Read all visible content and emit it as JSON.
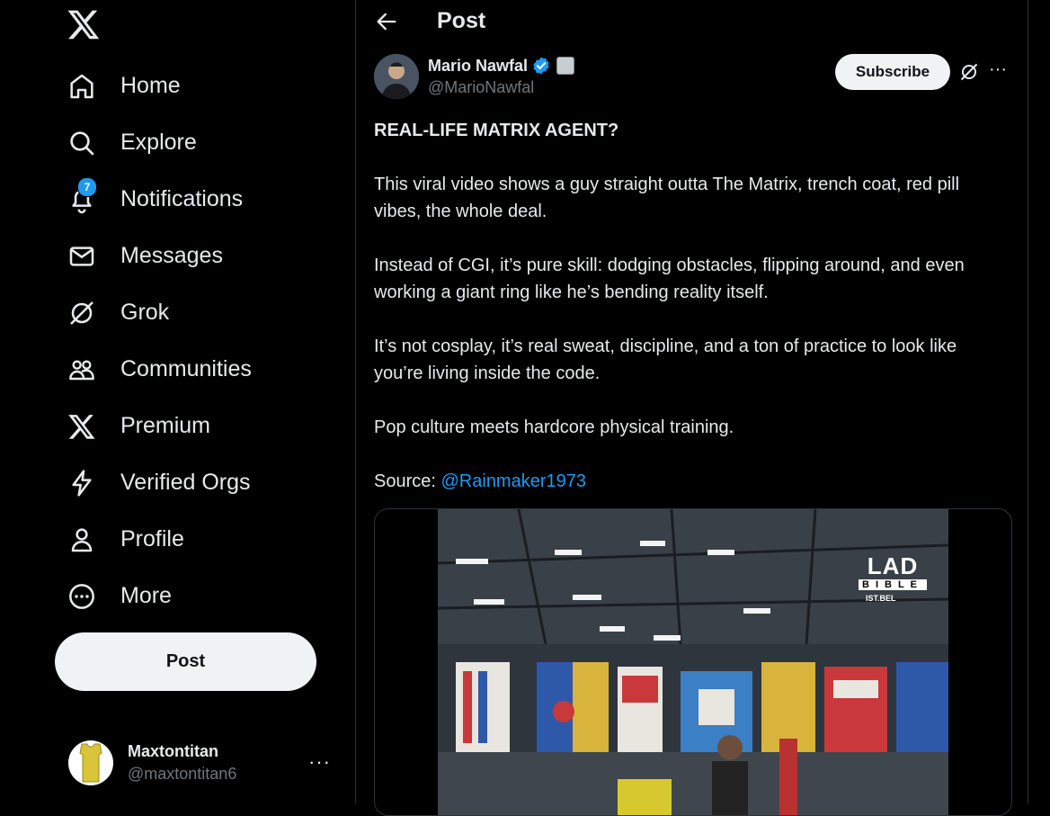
{
  "sidebar": {
    "nav": [
      {
        "label": "Home",
        "icon": "home-icon"
      },
      {
        "label": "Explore",
        "icon": "search-icon"
      },
      {
        "label": "Notifications",
        "icon": "bell-icon",
        "badge": "7"
      },
      {
        "label": "Messages",
        "icon": "envelope-icon"
      },
      {
        "label": "Grok",
        "icon": "grok-icon"
      },
      {
        "label": "Communities",
        "icon": "people-icon"
      },
      {
        "label": "Premium",
        "icon": "x-logo-icon"
      },
      {
        "label": "Verified Orgs",
        "icon": "lightning-icon"
      },
      {
        "label": "Profile",
        "icon": "person-icon"
      },
      {
        "label": "More",
        "icon": "more-circle-icon"
      }
    ],
    "post_label": "Post",
    "account": {
      "name": "Maxtontitan",
      "handle": "@maxtontitan6",
      "more": "···"
    }
  },
  "header": {
    "title": "Post"
  },
  "post": {
    "author": {
      "name": "Mario Nawfal",
      "handle": "@MarioNawfal"
    },
    "subscribe_label": "Subscribe",
    "more": "···",
    "headline": "REAL-LIFE MATRIX AGENT?",
    "paragraphs": [
      "This viral video shows a guy straight outta The Matrix, trench coat, red pill vibes, the whole deal.",
      "Instead of CGI, it’s pure skill: dodging obstacles, flipping around, and even working a giant ring like he’s bending reality itself.",
      "It’s not cosplay, it’s real sweat, discipline, and a ton of practice to look like you’re living inside the code.",
      "Pop culture meets hardcore physical training."
    ],
    "source_label": "Source:",
    "source_link": "@Rainmaker1973",
    "watermark": {
      "top": "LAD",
      "mid": "BIBLE",
      "sub": "IST.BEL"
    }
  },
  "colors": {
    "accent": "#1d9bf0",
    "background": "#000000",
    "text": "#e7e9ea",
    "muted": "#71767b"
  }
}
